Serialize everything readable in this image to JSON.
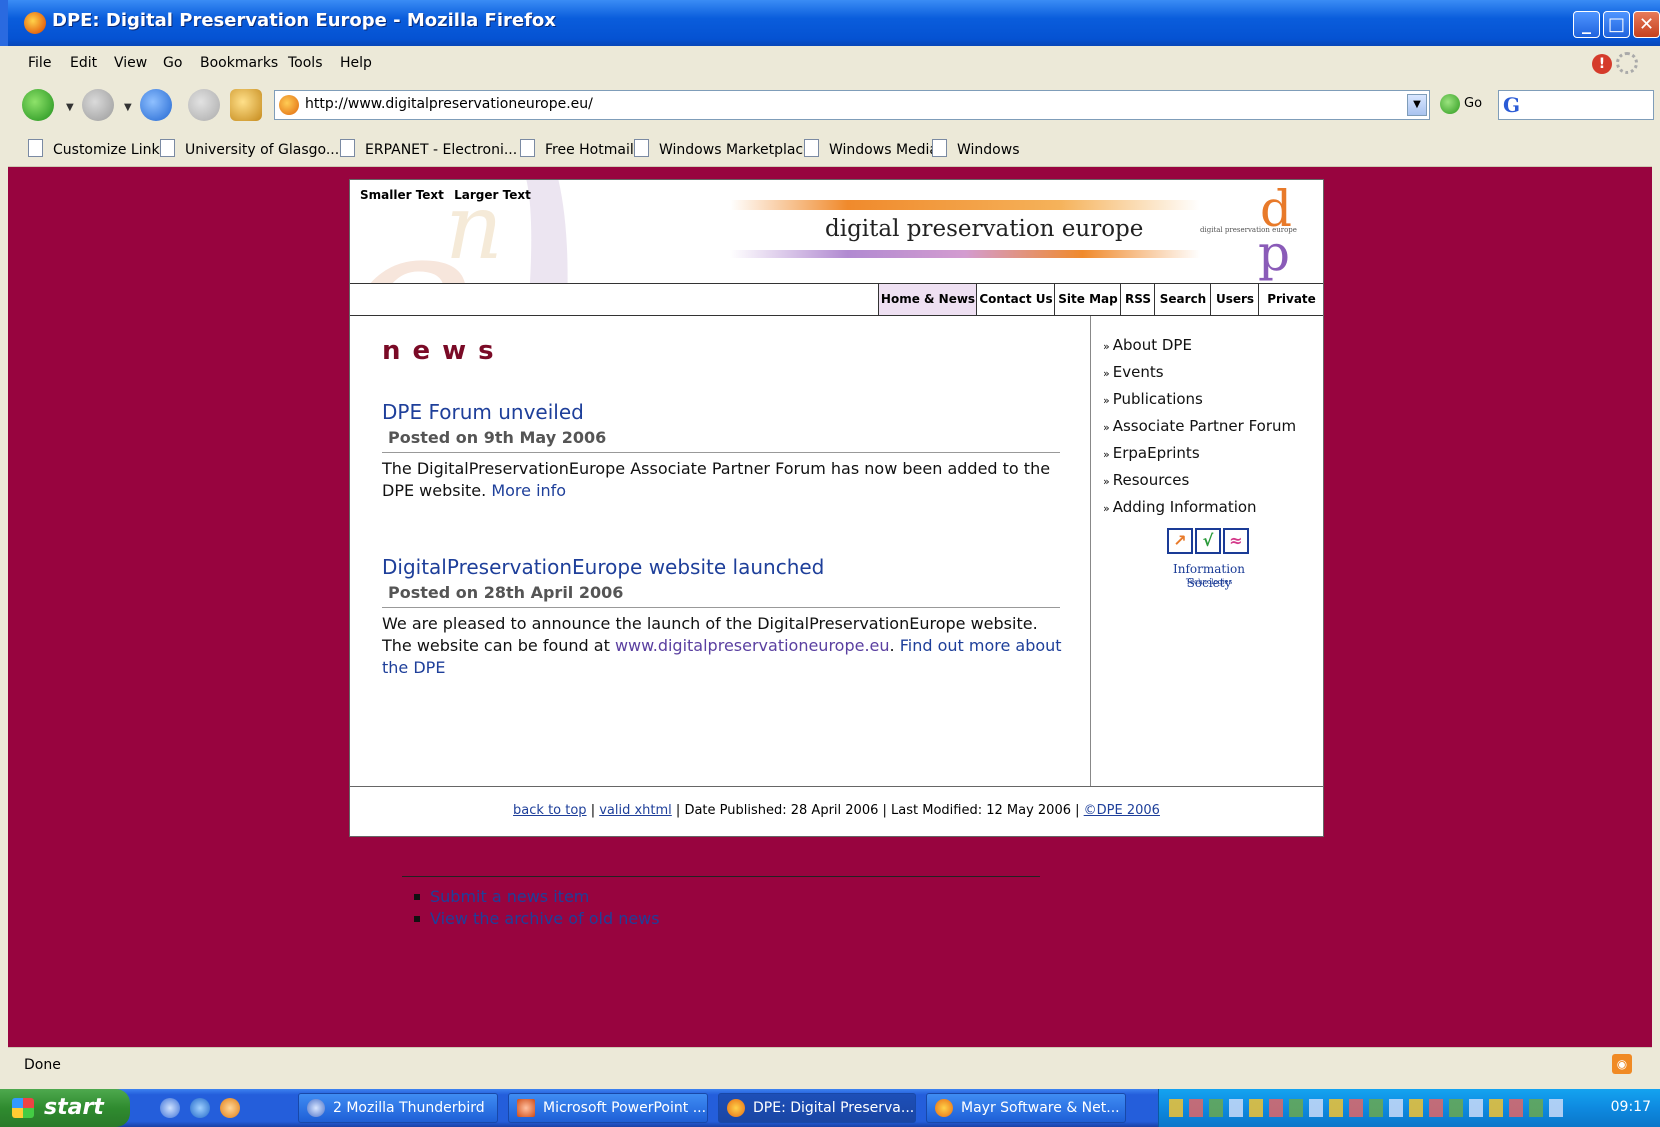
{
  "window": {
    "title": "DPE: Digital Preservation Europe - Mozilla Firefox",
    "controls": [
      "_",
      "□",
      "✕"
    ]
  },
  "menu": [
    "File",
    "Edit",
    "View",
    "Go",
    "Bookmarks",
    "Tools",
    "Help"
  ],
  "navbar": {
    "url": "http://www.digitalpreservationeurope.eu/",
    "go_label": "Go"
  },
  "bookmarks": [
    "Customize Links",
    "University of Glasgo...",
    "ERPANET - Electroni...",
    "Free Hotmail",
    "Windows Marketplace",
    "Windows Media",
    "Windows"
  ],
  "page": {
    "text_size": {
      "smaller": "Smaller Text",
      "larger": "Larger Text"
    },
    "banner_title": "digital preservation europe",
    "logo_small": "digital preservation europe",
    "tabs": [
      "Home & News",
      "Contact Us",
      "Site Map",
      "RSS",
      "Search",
      "Users",
      "Private"
    ],
    "news_heading": "news",
    "items": [
      {
        "title": "DPE Forum unveiled",
        "date": "Posted on 9th May 2006",
        "body": "The DigitalPreservationEurope Associate Partner Forum has now been added to the DPE website.",
        "link": "More info"
      },
      {
        "title": "DigitalPreservationEurope website launched",
        "date": "Posted on 28th April 2006",
        "body": "We are pleased to announce the launch of the DigitalPreservationEurope website. The website can be found at",
        "url_link": "www.digitalpreservationeurope.eu",
        "link": "Find out more about the DPE"
      }
    ],
    "bullets": [
      "Submit a news item",
      "View the archive of old news"
    ],
    "sidebar": [
      "About DPE",
      "Events",
      "Publications",
      "Associate Partner Forum",
      "ErpaEprints",
      "Resources",
      "Adding Information"
    ],
    "ist": {
      "name": "Information Society",
      "sub": "Technologies"
    },
    "footer": {
      "back_to_top": "back to top",
      "valid_xhtml": "valid xhtml",
      "published": "Date Published: 28 April 2006",
      "modified": "Last Modified: 12 May 2006",
      "copyright": "©DPE 2006",
      "sep": " | "
    }
  },
  "status": {
    "text": "Done"
  },
  "taskbar": {
    "start": "start",
    "buttons": [
      "2 Mozilla Thunderbird",
      "Microsoft PowerPoint ...",
      "DPE: Digital Preserva...",
      "Mayr Software & Net..."
    ],
    "clock": "09:17"
  },
  "colors": {
    "page_bg": "#98043f",
    "link": "#1e3f9a",
    "accent": "#e87a2a"
  }
}
